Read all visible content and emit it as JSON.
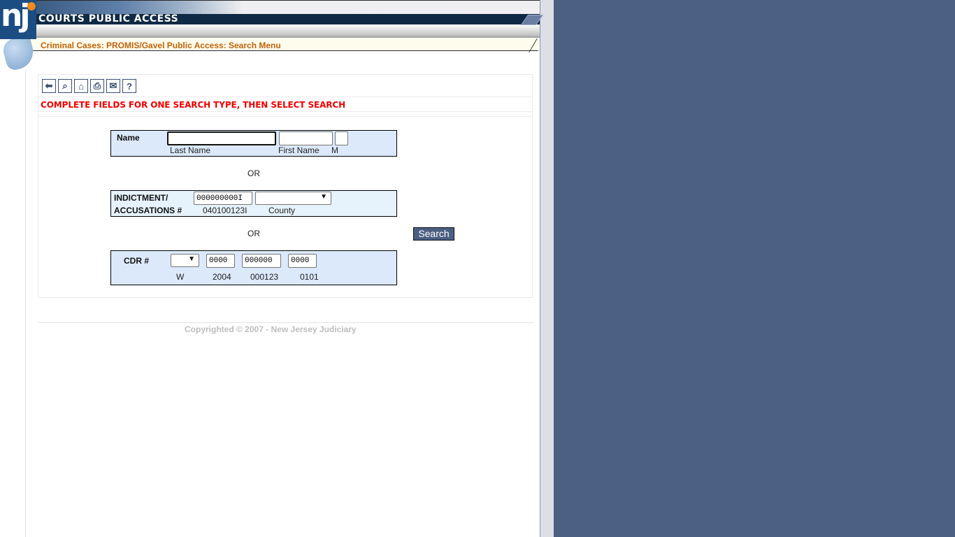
{
  "header": {
    "logo_text": "nj",
    "title": "COURTS PUBLIC ACCESS",
    "breadcrumb": "Criminal Cases: PROMIS/Gavel Public Access: Search Menu"
  },
  "toolbar": {
    "icons": [
      {
        "name": "back-arrow-icon",
        "glyph": "⬅"
      },
      {
        "name": "search-zoom-icon",
        "glyph": "⌕"
      },
      {
        "name": "home-icon",
        "glyph": "⌂"
      },
      {
        "name": "print-icon",
        "glyph": "⎙"
      },
      {
        "name": "email-icon",
        "glyph": "✉"
      },
      {
        "name": "help-icon",
        "glyph": "?"
      }
    ]
  },
  "instruction": "COMPLETE FIELDS FOR ONE SEARCH TYPE, THEN SELECT SEARCH",
  "name_search": {
    "label": "Name",
    "last_name_value": "",
    "first_name_value": "",
    "middle_value": "",
    "last_name_caption": "Last Name",
    "first_name_caption": "First Name",
    "middle_caption": "M"
  },
  "or_text": "OR",
  "indictment_search": {
    "label_line1": "INDICTMENT/",
    "label_line2": "ACCUSATIONS #",
    "number_value": "000000000I",
    "number_caption": "040100123I",
    "county_selected": "",
    "county_caption": "County"
  },
  "cdr_search": {
    "label": "CDR #",
    "type_selected": "",
    "year_value": "0000",
    "seq_value": "000000",
    "suffix_value": "0000",
    "type_caption": "W",
    "year_caption": "2004",
    "seq_caption": "000123",
    "suffix_caption": "0101"
  },
  "search_button": "Search",
  "footer": {
    "copyright": "Copyrighted © 2007 - New Jersey Judiciary"
  },
  "colors": {
    "header_band": "#0f2a44",
    "breadcrumb_text": "#c0620a",
    "instruction_text": "#ee0000",
    "button_bg": "#4a5f82",
    "outside_bg": "#4b6082"
  }
}
